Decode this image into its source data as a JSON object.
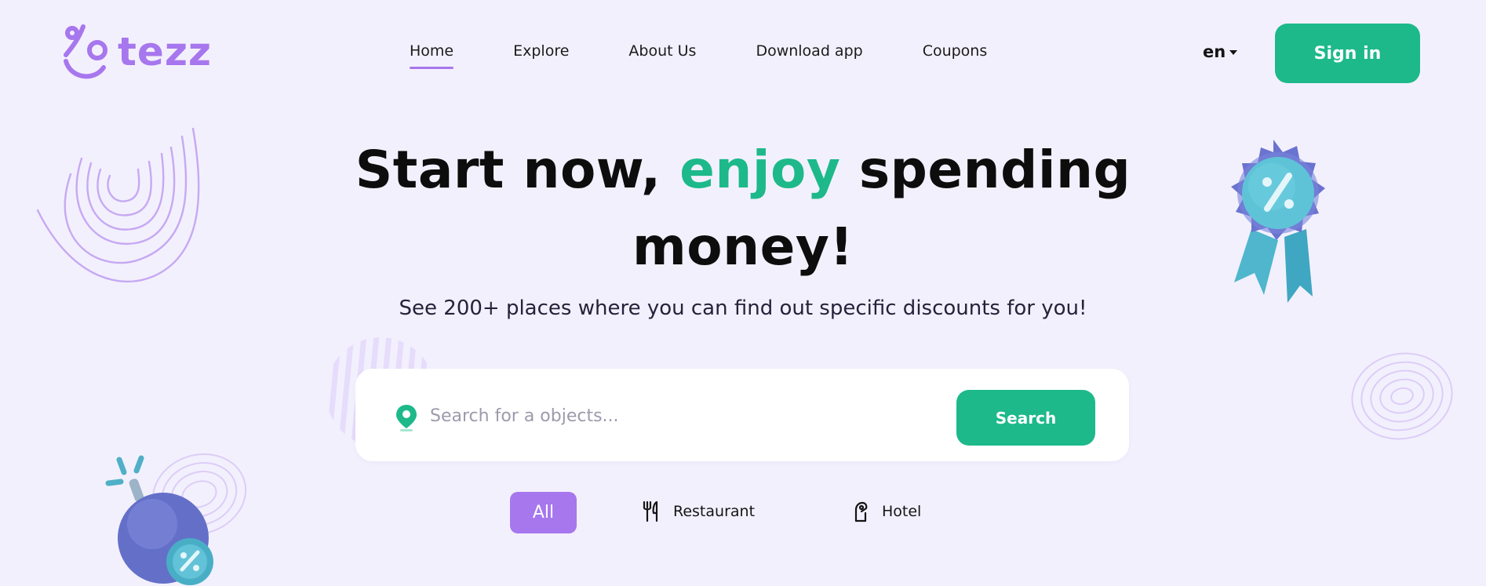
{
  "brand": {
    "name": "tezz",
    "accent": "#a777ee",
    "green": "#1db98a"
  },
  "nav": {
    "items": [
      {
        "label": "Home",
        "active": true
      },
      {
        "label": "Explore"
      },
      {
        "label": "About Us"
      },
      {
        "label": "Download app"
      },
      {
        "label": "Coupons"
      }
    ]
  },
  "header": {
    "language": "en",
    "signin_label": "Sign in"
  },
  "hero": {
    "title_part1": "Start now,",
    "title_accent": "enjoy",
    "title_part2": "spending",
    "title_line2": "money!",
    "subtitle": "See 200+ places where you can find out specific discounts for you!"
  },
  "search": {
    "placeholder": "Search for a objects...",
    "button_label": "Search",
    "icon": "location-pin-icon"
  },
  "categories": [
    {
      "label": "All",
      "selected": true
    },
    {
      "label": "Restaurant",
      "icon": "fork-knife-icon"
    },
    {
      "label": "Hotel",
      "icon": "hotel-tag-icon"
    }
  ]
}
